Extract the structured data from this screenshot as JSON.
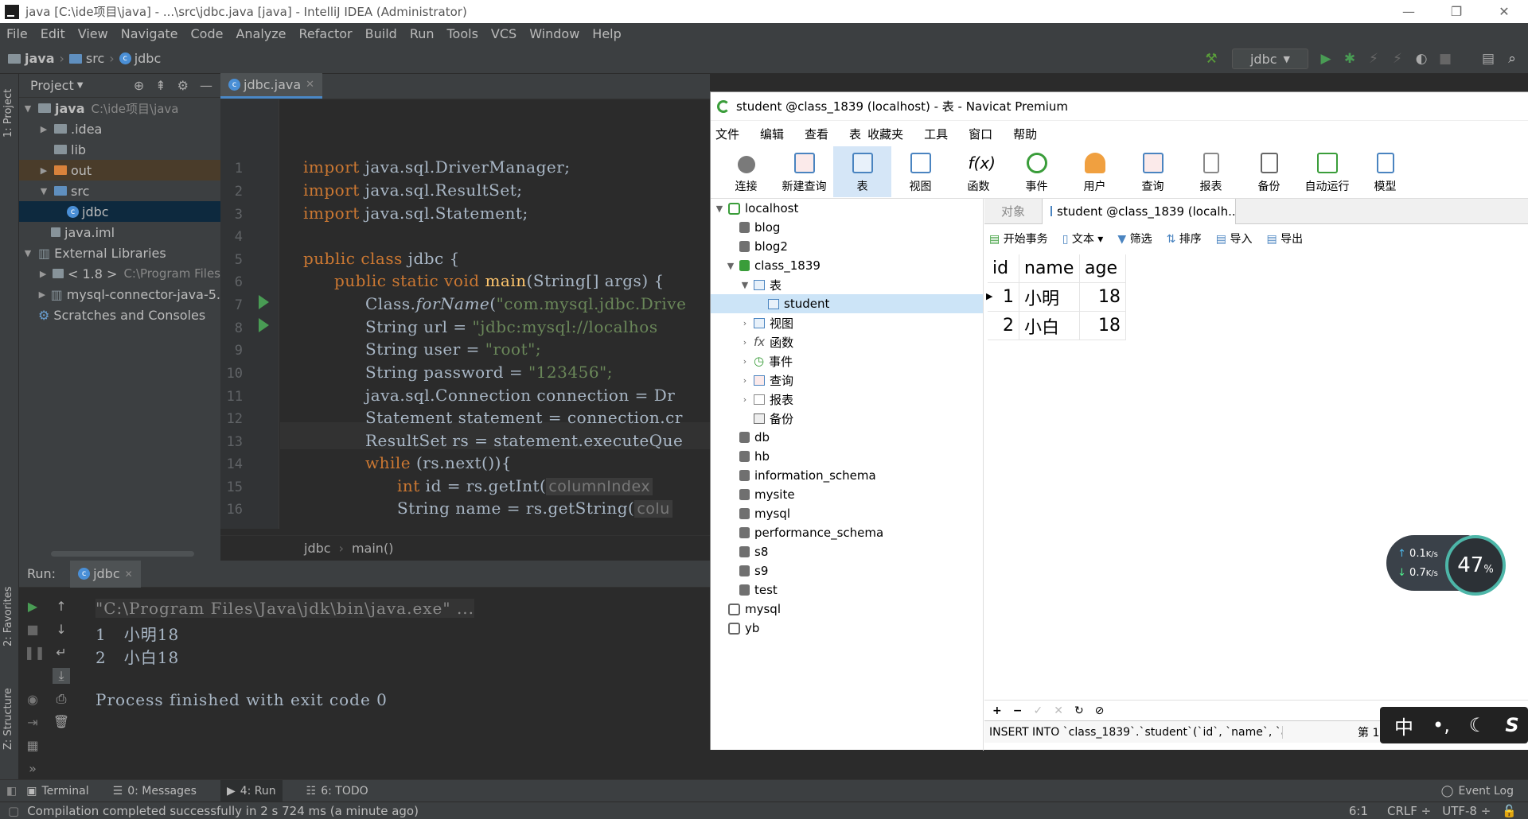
{
  "ide": {
    "title": "java [C:\\ide项目\\java] - ...\\src\\jdbc.java [java] - IntelliJ IDEA (Administrator)",
    "menu": [
      "File",
      "Edit",
      "View",
      "Navigate",
      "Code",
      "Analyze",
      "Refactor",
      "Build",
      "Run",
      "Tools",
      "VCS",
      "Window",
      "Help"
    ],
    "breadcrumb": [
      "java",
      "src",
      "jdbc"
    ],
    "run_config": "jdbc",
    "left_strip": {
      "project": "1: Project",
      "favorites": "2: Favorites",
      "structure": "Z: Structure"
    },
    "project_panel": {
      "title": "Project",
      "tree": [
        {
          "label": "java",
          "dim": "C:\\ide项目\\java"
        },
        {
          "label": ".idea"
        },
        {
          "label": "lib"
        },
        {
          "label": "out"
        },
        {
          "label": "src"
        },
        {
          "label": "jdbc"
        },
        {
          "label": "java.iml"
        },
        {
          "label": "External Libraries"
        },
        {
          "label": "< 1.8 >",
          "dim": "C:\\Program Files"
        },
        {
          "label": "mysql-connector-java-5."
        },
        {
          "label": "Scratches and Consoles"
        }
      ]
    },
    "editor": {
      "tab": "jdbc.java",
      "line_numbers": [
        "1",
        "2",
        "3",
        "4",
        "5",
        "6",
        "7",
        "8",
        "9",
        "10",
        "11",
        "12",
        "13",
        "14",
        "15",
        "16"
      ],
      "lines": [
        [
          "import",
          " java.sql.DriverManager;"
        ],
        [
          "import",
          " java.sql.ResultSet;"
        ],
        [
          "import",
          " java.sql.Statement;"
        ],
        [
          "",
          ""
        ],
        [
          "public class ",
          "jdbc {"
        ],
        [
          "public static void ",
          "main",
          "(String[] args) {"
        ],
        [
          "Class.",
          "forName",
          "(",
          "\"com.mysql.jdbc.Drive"
        ],
        [
          "String url = ",
          "\"jdbc:mysql://localhos"
        ],
        [
          "String user = ",
          "\"root\";"
        ],
        [
          "String password = ",
          "\"123456\";"
        ],
        [
          "java.sql.Connection connection = Dr"
        ],
        [
          "Statement statement = connection.cr"
        ],
        [
          "ResultSet rs = statement.executeQue"
        ],
        [
          "while",
          " (rs.next()){"
        ],
        [
          "int",
          " id = rs.getInt(",
          "columnIndex"
        ],
        [
          "String name = rs.getString(",
          "colu"
        ]
      ],
      "breadcrumb": [
        "jdbc",
        "main()"
      ]
    },
    "run_panel": {
      "label": "Run:",
      "tab": "jdbc",
      "console": [
        "\"C:\\Program Files\\Java\\jdk\\bin\\java.exe\" ...",
        "1   小明18",
        "2   小白18",
        "",
        "Process finished with exit code 0"
      ]
    },
    "bottom_tabs": [
      "Terminal",
      "0: Messages",
      "4: Run",
      "6: TODO"
    ],
    "event_log": "Event Log",
    "status": {
      "message": "Compilation completed successfully in 2 s 724 ms (a minute ago)",
      "position": "6:1",
      "line_sep": "CRLF ÷",
      "encoding": "UTF-8 ÷"
    }
  },
  "navicat": {
    "title": "student @class_1839 (localhost) - 表 - Navicat Premium",
    "menu": [
      "文件",
      "编辑",
      "查看",
      "表",
      "收藏夹",
      "工具",
      "窗口",
      "帮助"
    ],
    "toolbar": [
      "连接",
      "新建查询",
      "表",
      "视图",
      "函数",
      "事件",
      "用户",
      "查询",
      "报表",
      "备份",
      "自动运行",
      "模型"
    ],
    "tree": {
      "root": "localhost",
      "dbs_before": [
        "blog",
        "blog2"
      ],
      "open_db": "class_1839",
      "table_group": "表",
      "table": "student",
      "groups": [
        "视图",
        "函数",
        "事件",
        "查询",
        "报表",
        "备份"
      ],
      "dbs_after": [
        "db",
        "hb",
        "information_schema",
        "mysite",
        "mysql",
        "performance_schema",
        "s8",
        "s9",
        "test"
      ],
      "connections": [
        "mysql",
        "yb"
      ]
    },
    "tabs": {
      "objects": "对象",
      "current": "student @class_1839 (localh..."
    },
    "actions": [
      "开始事务",
      "文本 ▾",
      "筛选",
      "排序",
      "导入",
      "导出"
    ],
    "grid": {
      "columns": [
        "id",
        "name",
        "age"
      ],
      "rows": [
        [
          "1",
          "小明",
          "18"
        ],
        [
          "2",
          "小白",
          "18"
        ]
      ]
    },
    "sql": "INSERT INTO `class_1839`.`student`(`id`, `name`, `age",
    "page": "第 1"
  },
  "widgets": {
    "net_up": "0.1",
    "net_down": "0.7",
    "net_unit": "K/s",
    "cpu": "47",
    "cpu_unit": "%",
    "ime_lang": "中"
  }
}
